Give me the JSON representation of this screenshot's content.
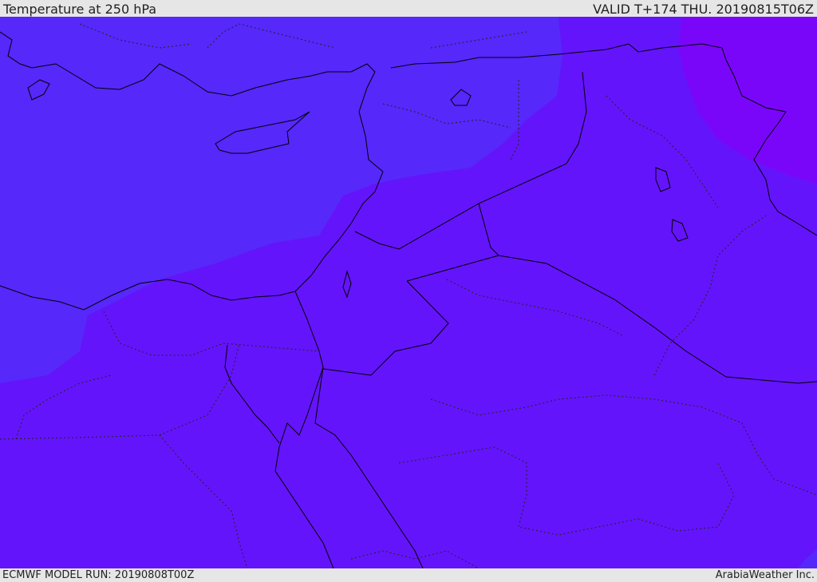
{
  "header": {
    "title": "Temperature at 250 hPa",
    "valid": "VALID T+174 THU. 20190815T06Z"
  },
  "footer": {
    "model_run": "ECMWF MODEL RUN: 20190808T00Z",
    "credit": "ArabiaWeather Inc."
  },
  "map": {
    "colors": {
      "band_cold": "#5628fa",
      "band_mid": "#6414fa",
      "band_warm": "#7a06fa",
      "outline": "#000000"
    }
  }
}
